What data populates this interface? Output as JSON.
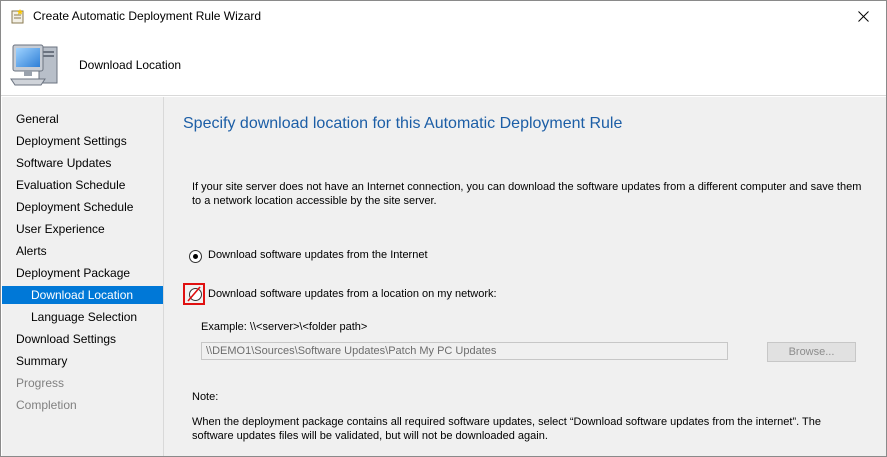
{
  "window": {
    "title": "Create Automatic Deployment Rule Wizard",
    "header_title": "Download Location"
  },
  "sidebar": {
    "items": [
      {
        "label": "General",
        "state": "normal",
        "indent": false
      },
      {
        "label": "Deployment Settings",
        "state": "normal",
        "indent": false
      },
      {
        "label": "Software Updates",
        "state": "normal",
        "indent": false
      },
      {
        "label": "Evaluation Schedule",
        "state": "normal",
        "indent": false
      },
      {
        "label": "Deployment Schedule",
        "state": "normal",
        "indent": false
      },
      {
        "label": "User Experience",
        "state": "normal",
        "indent": false
      },
      {
        "label": "Alerts",
        "state": "normal",
        "indent": false
      },
      {
        "label": "Deployment Package",
        "state": "normal",
        "indent": false
      },
      {
        "label": "Download Location",
        "state": "selected",
        "indent": true
      },
      {
        "label": "Language Selection",
        "state": "normal",
        "indent": true
      },
      {
        "label": "Download Settings",
        "state": "normal",
        "indent": false
      },
      {
        "label": "Summary",
        "state": "normal",
        "indent": false
      },
      {
        "label": "Progress",
        "state": "disabled",
        "indent": false
      },
      {
        "label": "Completion",
        "state": "disabled",
        "indent": false
      }
    ]
  },
  "main": {
    "title": "Specify download location for this Automatic Deployment Rule",
    "description": "If your site server does not have an Internet connection, you can download the software updates from a different computer and save them to a network location accessible by the site server.",
    "option_internet": {
      "label": "Download software updates from the Internet",
      "selected": true
    },
    "option_network": {
      "label": "Download software updates from a location on my network:",
      "selected": false
    },
    "example": "Example: \\\\<server>\\<folder path>",
    "path_value": "\\\\DEMO1\\Sources\\Software Updates\\Patch My PC Updates",
    "browse_label": "Browse...",
    "note_label": "Note:",
    "note_text": "When the deployment package contains all required software updates, select “Download  software updates from the internet”. The software updates files will be validated, but will not be downloaded again."
  },
  "colors": {
    "accent": "#0078d7",
    "title_blue": "#1c5ea6",
    "highlight_red": "#e01010"
  }
}
